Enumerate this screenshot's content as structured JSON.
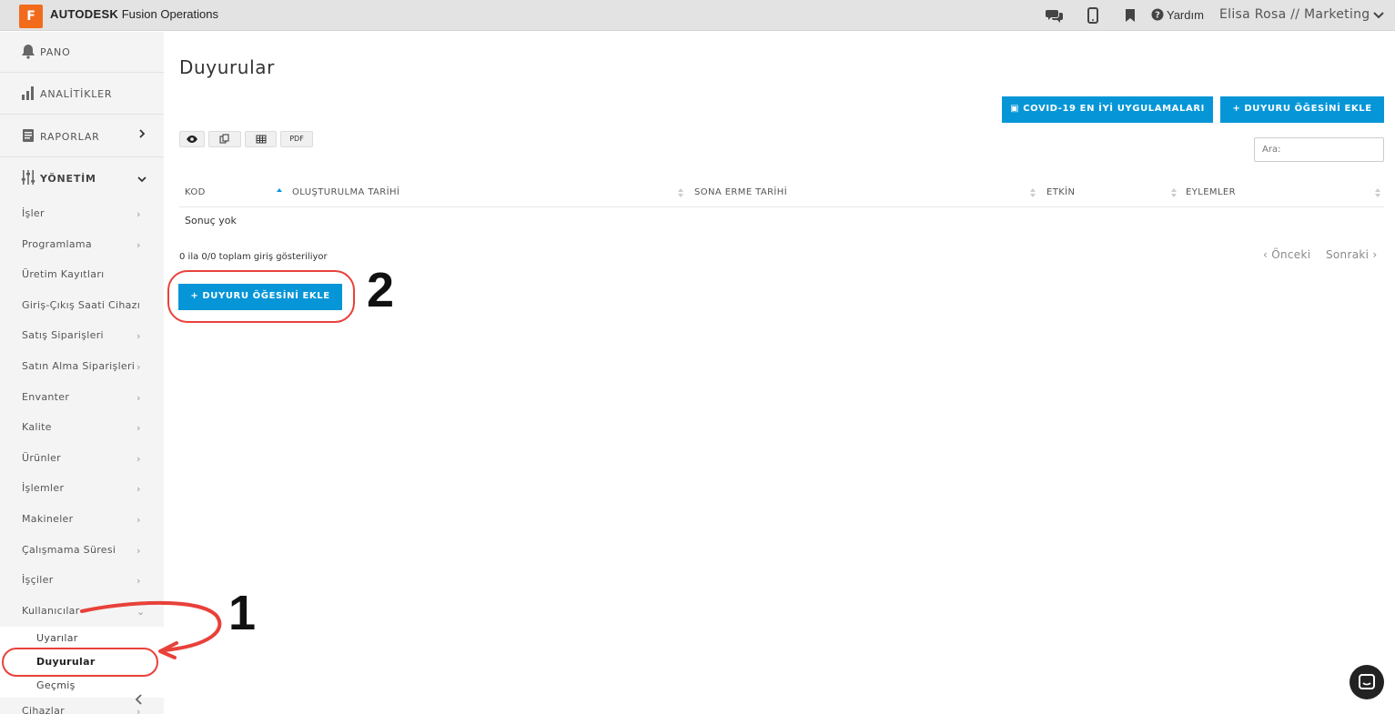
{
  "header": {
    "logo_letter": "F",
    "brand_strong": "AUTODESK",
    "brand_rest": " Fusion Operations",
    "help_label": "Yardım",
    "user_label": "Elisa Rosa // Marketing"
  },
  "sidebar": {
    "top_items": [
      {
        "label": "PANO",
        "icon": "bell-icon"
      },
      {
        "label": "ANALİTİKLER",
        "icon": "bar-chart-icon"
      },
      {
        "label": "RAPORLAR",
        "icon": "report-icon"
      },
      {
        "label": "YÖNETİM",
        "icon": "sliders-icon"
      }
    ],
    "items": [
      "İşler",
      "Programlama",
      "Üretim Kayıtları",
      "Giriş-Çıkış Saati Cihazı",
      "Satış Siparişleri",
      "Satın Alma Siparişleri",
      "Envanter",
      "Kalite",
      "Ürünler",
      "İşlemler",
      "Makineler",
      "Çalışmama Süresi",
      "İşçiler",
      "Kullanıcılar"
    ],
    "sub_items": [
      "Uyarılar",
      "Duyurular",
      "Geçmiş"
    ],
    "after_item": "Cihazlar"
  },
  "main": {
    "title": "Duyurular",
    "covid_button": "COVID-19 EN İYİ UYGULAMALARI",
    "add_button_top": "DUYURU ÖĞESİNİ EKLE",
    "tools": {
      "pdf": "PDF"
    },
    "search_placeholder": "Ara:",
    "columns": [
      "KOD",
      "OLUŞTURULMA TARİHİ",
      "SONA ERME TARİHİ",
      "ETKİN",
      "EYLEMLER"
    ],
    "empty_text": "Sonuç yok",
    "info_text": "0 ila 0/0 toplam giriş gösteriliyor",
    "prev_label": "‹ Önceki",
    "next_label": "Sonraki ›",
    "add_button_bottom": "DUYURU ÖĞESİNİ EKLE"
  },
  "annotations": {
    "step1": "1",
    "step2": "2"
  },
  "colors": {
    "accent": "#0696d7",
    "brand": "#f26b1d",
    "annotation": "#e8413a"
  }
}
